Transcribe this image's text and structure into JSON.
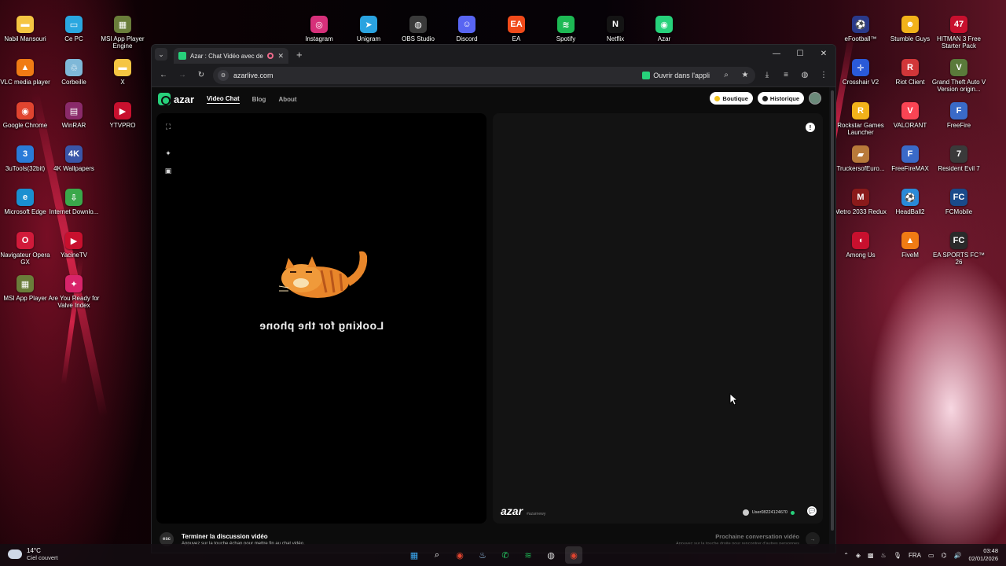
{
  "desktop": {
    "left_icons": [
      {
        "label": "Nabil Mansouri",
        "color": "#f5c542",
        "glyph": "▬"
      },
      {
        "label": "Ce PC",
        "color": "#2aa7e0",
        "glyph": "▭"
      },
      {
        "label": "MSI App Player Engine",
        "color": "#6a7d3a",
        "glyph": "▦"
      },
      {
        "label": "VLC media player",
        "color": "#f07b14",
        "glyph": "▲"
      },
      {
        "label": "Corbeille",
        "color": "#7fb8d8",
        "glyph": "♲"
      },
      {
        "label": "X",
        "color": "#f5c542",
        "glyph": "▬"
      },
      {
        "label": "Google Chrome",
        "color": "#e0442f",
        "glyph": "◉"
      },
      {
        "label": "WinRAR",
        "color": "#8a2a6a",
        "glyph": "▤"
      },
      {
        "label": "YTVPRO",
        "color": "#c8102e",
        "glyph": "▶"
      },
      {
        "label": "3uTools(32bit)",
        "color": "#2a7bd8",
        "glyph": "3"
      },
      {
        "label": "4K Wallpapers",
        "color": "#3a56a8",
        "glyph": "4K"
      },
      {
        "label": "Microsoft Edge",
        "color": "#1a8fd0",
        "glyph": "e"
      },
      {
        "label": "Internet Downlo...",
        "color": "#3aa84a",
        "glyph": "⇩"
      },
      {
        "label": "Navigateur Opera GX",
        "color": "#d11a3a",
        "glyph": "O"
      },
      {
        "label": "YacineTV",
        "color": "#c8102e",
        "glyph": "▶"
      },
      {
        "label": "MSI App Player",
        "color": "#6a7d3a",
        "glyph": "▦"
      },
      {
        "label": "Are You Ready for Valve Index",
        "color": "#d8246a",
        "glyph": "✦"
      }
    ],
    "top_icons": [
      {
        "label": "Instagram",
        "color": "#d6307a",
        "glyph": "◎"
      },
      {
        "label": "Unigram",
        "color": "#2aa3e0",
        "glyph": "➤"
      },
      {
        "label": "OBS Studio",
        "color": "#3a3a3a",
        "glyph": "◍"
      },
      {
        "label": "Discord",
        "color": "#5865f2",
        "glyph": "☺"
      },
      {
        "label": "EA",
        "color": "#f04a1a",
        "glyph": "EA"
      },
      {
        "label": "Spotify",
        "color": "#1db954",
        "glyph": "≋"
      },
      {
        "label": "Netflix",
        "color": "#141414",
        "glyph": "N"
      },
      {
        "label": "Azar",
        "color": "#27d17b",
        "glyph": "◉"
      }
    ],
    "right_icons": [
      {
        "label": "eFootball™",
        "color": "#2a3a8a",
        "glyph": "⚽"
      },
      {
        "label": "Stumble Guys",
        "color": "#f2b21a",
        "glyph": "☻"
      },
      {
        "label": "HITMAN 3 Free Starter Pack",
        "color": "#c8102e",
        "glyph": "47"
      },
      {
        "label": "Crosshair V2",
        "color": "#2a5ad8",
        "glyph": "✛"
      },
      {
        "label": "Riot Client",
        "color": "#d13639",
        "glyph": "R"
      },
      {
        "label": "Grand Theft Auto V Version origin...",
        "color": "#5a7a3a",
        "glyph": "V"
      },
      {
        "label": "Rockstar Games Launcher",
        "color": "#f2b21a",
        "glyph": "R"
      },
      {
        "label": "VALORANT",
        "color": "#fa4454",
        "glyph": "V"
      },
      {
        "label": "FreeFire",
        "color": "#3a6ac8",
        "glyph": "F"
      },
      {
        "label": "TruckersofEuro...",
        "color": "#b87a3a",
        "glyph": "▰"
      },
      {
        "label": "FreeFireMAX",
        "color": "#3a6ac8",
        "glyph": "F"
      },
      {
        "label": "Resident Evil 7",
        "color": "#3a3a3a",
        "glyph": "7"
      },
      {
        "label": "Metro 2033 Redux",
        "color": "#8a1a1a",
        "glyph": "M"
      },
      {
        "label": "HeadBall2",
        "color": "#2a8ad8",
        "glyph": "⚽"
      },
      {
        "label": "FCMobile",
        "color": "#1a4a8a",
        "glyph": "FC"
      },
      {
        "label": "Among Us",
        "color": "#c8102e",
        "glyph": "◖"
      },
      {
        "label": "FiveM",
        "color": "#f07b14",
        "glyph": "▲"
      },
      {
        "label": "EA SPORTS FC™ 26",
        "color": "#2a2a2a",
        "glyph": "FC"
      }
    ]
  },
  "browser": {
    "tab_title": "Azar : Chat Vidéo avec de n",
    "url": "azarlive.com",
    "open_in_app": "Ouvrir dans l'appli"
  },
  "page": {
    "brand": "azar",
    "nav": [
      "Video Chat",
      "Blog",
      "About"
    ],
    "shop_label": "Boutique",
    "history_label": "Historique",
    "looking_text": "Looking for the phone",
    "watermark": "azar",
    "watermark_sub": "#azarnewy",
    "user_id": "User08224124670",
    "end_title": "Terminer la discussion vidéo",
    "end_hint": "Appuyez sur la touche échap pour mettre fin au chat vidéo.",
    "esc_label": "esc",
    "next_title": "Prochaine conversation vidéo",
    "next_hint": "Appuyez sur la touche droite pour rencontrer d'autres personnes"
  },
  "taskbar": {
    "temperature": "14°C",
    "weather": "Ciel couvert",
    "language": "FRA",
    "time": "03:48",
    "date": "02/01/2026"
  }
}
